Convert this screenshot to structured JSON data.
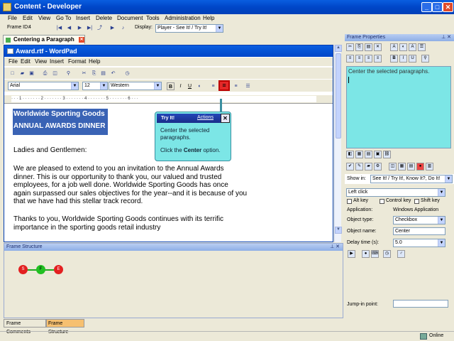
{
  "window": {
    "title": "Content - Developer",
    "buttons": [
      "_",
      "□",
      "✕"
    ]
  },
  "menu": [
    "File",
    "Edit",
    "View",
    "Go To",
    "Insert",
    "Delete",
    "Document",
    "Tools",
    "Administration",
    "Help"
  ],
  "toolbar": {
    "frame_label": "Frame ID:",
    "frame_id": "4",
    "display_label": "Display:",
    "display_value": "Player - See It! / Try It!"
  },
  "doc_tab": {
    "label": "Centering a Paragraph"
  },
  "wordpad": {
    "title": "Award.rtf - WordPad",
    "menu": [
      "File",
      "Edit",
      "View",
      "Insert",
      "Format",
      "Help"
    ],
    "font": "Arial",
    "size": "12",
    "script": "Western",
    "format_buttons": [
      "B",
      "I",
      "U"
    ],
    "ruler": "· · · 1 · · · · · · · 2 · · · · · · · 3 · · · · · · · 4 · · · · · · · 5 · · · · · · · 6 · · ·",
    "heading1": "Worldwide Sporting Goods",
    "heading2": "ANNUAL AWARDS DINNER",
    "salutation": "Ladies and Gentlemen:",
    "para1": [
      "We are pleased to extend to you an invitation to the Annual Awards",
      "dinner.  This is our opportunity to thank you, our valued and trusted",
      "employees, for a job well done.  Worldwide Sporting Goods has once",
      "again surpassed our sales objectives for the year--and it is because of you",
      "that we have had this stellar track record."
    ],
    "para2": [
      "Thanks to you, Worldwide Sporting Goods continues with its terrific",
      "importance in the sporting goods retail industry"
    ]
  },
  "tooltip": {
    "title": "Try It!",
    "actions": "Actions",
    "close": "✕",
    "line1": "Center the selected",
    "line2": "paragraphs.",
    "line3_pre": "Click the ",
    "line3_bold": "Center",
    "line3_post": " option."
  },
  "frame_structure": {
    "title": "Frame Structure",
    "nodes": [
      "S",
      "F",
      "E"
    ],
    "pin": "⊥ ✕"
  },
  "bottom_tabs": [
    "Frame Comments",
    "Frame Structure"
  ],
  "frame_properties": {
    "title": "Frame Properties",
    "text": "Center the selected paragraphs.",
    "show_in_label": "Show in:",
    "show_in_value": "See It! / Try It!, Know It?, Do It!",
    "event": "Left click",
    "alt": "Alt key",
    "ctrl": "Control key",
    "shift": "Shift key",
    "app_label": "Application:",
    "app_value": "Windows Application",
    "objtype_label": "Object type:",
    "objtype_value": "Checkbox",
    "objname_label": "Object name:",
    "objname_value": "Center",
    "delay_label": "Delay time (s):",
    "delay_value": "5.0",
    "jump_label": "Jump-in point:"
  },
  "status": {
    "online": "Online"
  },
  "colors": {
    "accent": "#0046c8",
    "highlight": "#3a63b5",
    "tooltip": "#7ce6e6",
    "start": "#e32020",
    "frame": "#22c022",
    "end": "#e32020"
  }
}
